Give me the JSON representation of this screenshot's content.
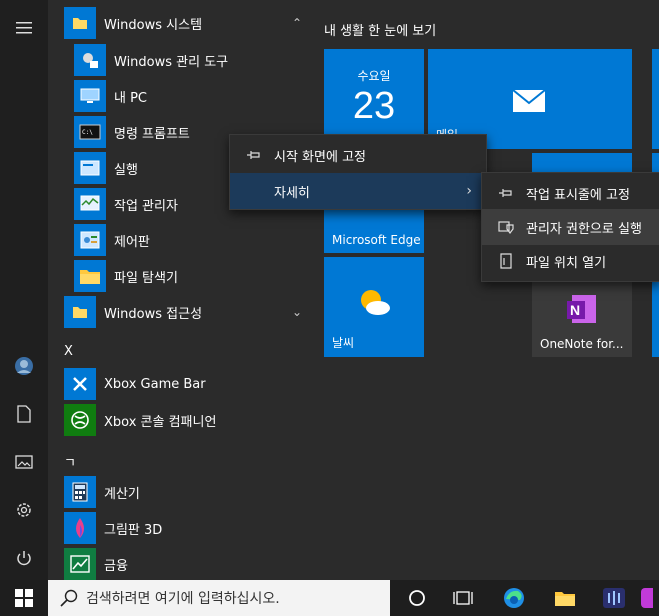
{
  "start_menu": {
    "rail": {
      "items": [
        "menu-icon",
        "avatar",
        "document-icon",
        "pictures-icon",
        "settings-icon",
        "power-icon"
      ]
    },
    "app_list": {
      "groups": [
        {
          "label": "Windows 시스템",
          "expanded": true,
          "items": [
            "Windows 관리 도구",
            "내 PC",
            "명령 프롬프트",
            "실행",
            "작업 관리자",
            "제어판",
            "파일 탐색기"
          ]
        },
        {
          "label": "Windows 접근성",
          "expanded": false
        }
      ],
      "section_x": "X",
      "x_items": [
        "Xbox Game Bar",
        "Xbox 콘솔 컴패니언"
      ],
      "section_g": "ㄱ",
      "g_items": [
        "계산기",
        "그림판 3D",
        "금융"
      ]
    },
    "tiles": {
      "group_title": "내 생활 한 눈에 보기",
      "calendar": {
        "day_name": "수요일",
        "day_num": "23"
      },
      "mail": {
        "label": "메일"
      },
      "edge": {
        "label": "Microsoft Edge"
      },
      "weather": {
        "label": "날씨"
      },
      "onenote": {
        "label": "OneNote for..."
      }
    },
    "context_menu": {
      "items": [
        {
          "label": "시작 화면에 고정",
          "icon": "pin-icon"
        },
        {
          "label": "자세히",
          "icon": "",
          "has_submenu": true
        }
      ]
    },
    "submenu": {
      "items": [
        {
          "label": "작업 표시줄에 고정",
          "icon": "pin-icon"
        },
        {
          "label": "관리자 권한으로 실행",
          "icon": "shield-icon"
        },
        {
          "label": "파일 위치 열기",
          "icon": "file-icon"
        }
      ]
    }
  },
  "taskbar": {
    "search_placeholder": "검색하려면 여기에 입력하십시오."
  },
  "colors": {
    "accent": "#0078d4",
    "menu_bg": "#2b2b2b",
    "highlight": "#1c3a5a"
  }
}
